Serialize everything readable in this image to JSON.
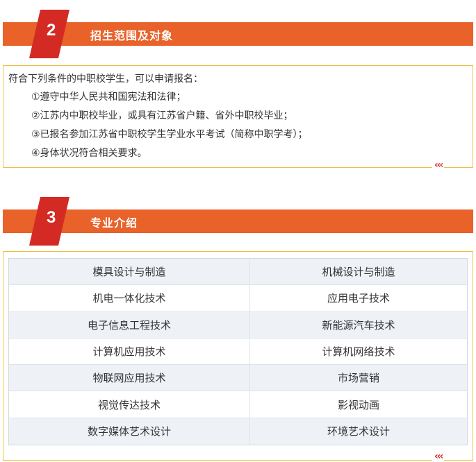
{
  "section2": {
    "number": "2",
    "title": "招生范围及对象",
    "intro": "符合下列条件的中职校学生，可以申请报名：",
    "items": [
      "①遵守中华人民共和国宪法和法律；",
      "②江苏内中职校毕业，或具有江苏省户籍、省外中职校毕业；",
      "③已报名参加江苏省中职校学生学业水平考试（简称中职学考）；",
      "④身体状况符合相关要求。"
    ],
    "chevrons": "‹‹‹"
  },
  "section3": {
    "number": "3",
    "title": "专业介绍",
    "majors": [
      [
        "模具设计与制造",
        "机械设计与制造"
      ],
      [
        "机电一体化技术",
        "应用电子技术"
      ],
      [
        "电子信息工程技术",
        "新能源汽车技术"
      ],
      [
        "计算机应用技术",
        "计算机网络技术"
      ],
      [
        "物联网应用技术",
        "市场营销"
      ],
      [
        "视觉传达技术",
        "影视动画"
      ],
      [
        "数字媒体艺术设计",
        "环境艺术设计"
      ]
    ],
    "chevrons": "‹‹‹"
  },
  "colors": {
    "header_orange": "#e8622a",
    "badge_red": "#d42a24",
    "box_border": "#f0c040",
    "row_alt": "#eef2f7"
  }
}
